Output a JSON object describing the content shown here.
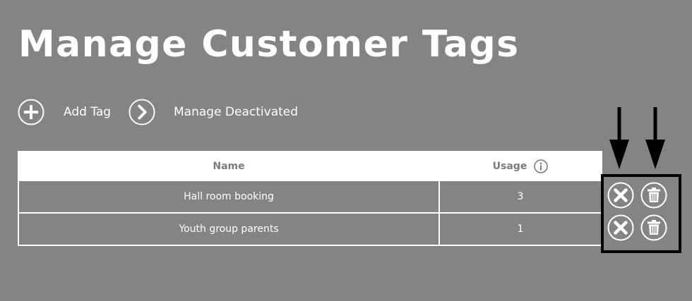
{
  "page": {
    "title": "Manage Customer Tags"
  },
  "actions": {
    "add_tag": {
      "label": "Add Tag",
      "icon": "plus-circle-icon"
    },
    "manage_deactivated": {
      "label": "Manage Deactivated",
      "icon": "chevron-right-circle-icon"
    }
  },
  "table": {
    "columns": {
      "name": "Name",
      "usage": "Usage"
    },
    "usage_info_icon": "info-icon",
    "rows": [
      {
        "name": "Hall room booking",
        "usage": "3",
        "deactivate_icon": "close-circle-icon",
        "delete_icon": "trash-icon"
      },
      {
        "name": "Youth group parents",
        "usage": "1",
        "deactivate_icon": "close-circle-icon",
        "delete_icon": "trash-icon"
      }
    ]
  },
  "annotations": {
    "arrow_icon": "down-arrow-icon",
    "highlight_color": "#000000"
  },
  "colors": {
    "background": "#848484",
    "text": "#ffffff",
    "header_text": "#7c7c7c"
  }
}
